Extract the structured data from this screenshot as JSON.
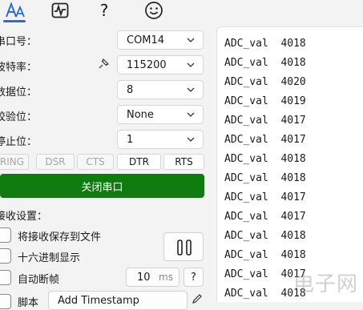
{
  "toolbar": {
    "items": [
      {
        "icon": "text-settings-icon"
      },
      {
        "icon": "waveform-icon"
      },
      {
        "icon": "help-icon",
        "label": "?"
      },
      {
        "icon": "smiley-icon",
        "label": "☺"
      }
    ],
    "accent": "#2b6cd6"
  },
  "serial": {
    "port_label": "串口号：",
    "port_value": "COM14",
    "baud_label": "波特率：",
    "baud_value": "115200",
    "databits_label": "数据位：",
    "databits_value": "8",
    "parity_label": "校验位：",
    "parity_value": "None",
    "stopbits_label": "停止位：",
    "stopbits_value": "1"
  },
  "signals": [
    {
      "label": "RING",
      "enabled": false
    },
    {
      "label": "DSR",
      "enabled": false
    },
    {
      "label": "CTS",
      "enabled": false
    },
    {
      "label": "DTR",
      "enabled": true
    },
    {
      "label": "RTS",
      "enabled": true
    }
  ],
  "close_button": {
    "label": "关闭串口",
    "color": "#0f7b0f"
  },
  "receive": {
    "title": "接收设置：",
    "save_to_file": "将接收保存到文件",
    "hex_display": "十六进制显示",
    "auto_frame": "自动断帧",
    "frame_ms": "10",
    "frame_unit": "ms",
    "help": "?",
    "script_label": "脚本",
    "script_value": "Add Timestamp"
  },
  "output_lines": [
    "ADC_val  4018",
    "ADC_val  4018",
    "ADC_val  4020",
    "ADC_val  4019",
    "ADC_val  4017",
    "ADC_val  4017",
    "ADC_val  4018",
    "ADC_val  4018",
    "ADC_val  4017",
    "ADC_val  4017",
    "ADC_val  4018",
    "ADC_val  4018",
    "ADC_val  4017",
    "ADC_val  4018"
  ],
  "watermark": "电子网"
}
